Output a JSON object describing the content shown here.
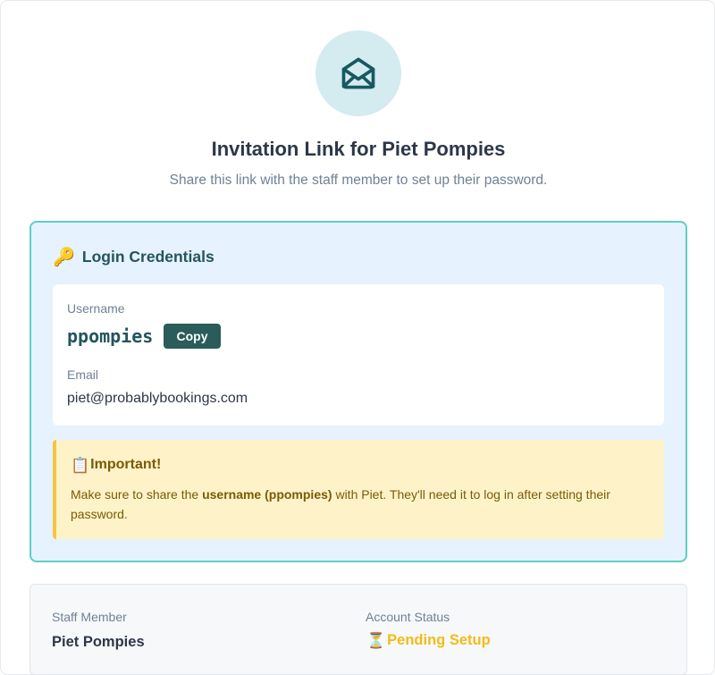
{
  "header": {
    "icon": "envelope-open-icon",
    "title": "Invitation Link for Piet Pompies",
    "subtitle": "Share this link with the staff member to set up their password."
  },
  "credentials": {
    "icon": "key-icon",
    "heading": "Login Credentials",
    "username_label": "Username",
    "username": "ppompies",
    "copy_label": "Copy",
    "email_label": "Email",
    "email": "piet@probablybookings.com"
  },
  "important": {
    "icon": "clipboard-icon",
    "title": "Important!",
    "text_before": "Make sure to share the ",
    "text_bold": "username (ppompies)",
    "text_after": " with Piet. They'll need it to log in after setting their password."
  },
  "info": {
    "staff_label": "Staff Member",
    "staff_value": "Piet Pompies",
    "status_label": "Account Status",
    "status_icon": "hourglass-icon",
    "status_value": "Pending Setup"
  },
  "colors": {
    "accent_teal": "#23555e",
    "panel_border": "#5fd0bf",
    "panel_bg": "#e6f2fd",
    "warning_bg": "#fef3c8",
    "warning_border": "#f6c343",
    "status_pending": "#f2bb16"
  }
}
